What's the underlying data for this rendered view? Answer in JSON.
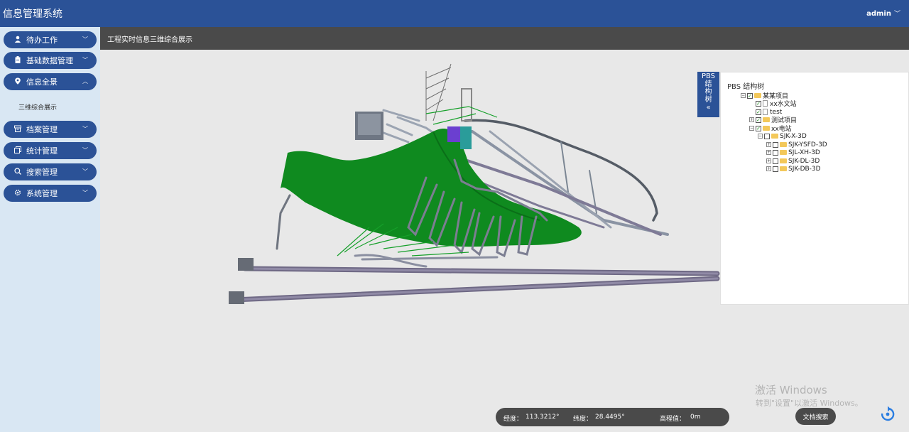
{
  "app": {
    "title": "信息管理系统",
    "user": "admin"
  },
  "sidebar": {
    "items": [
      {
        "label": "待办工作",
        "icon": "user-icon"
      },
      {
        "label": "基础数据管理",
        "icon": "clipboard-icon"
      },
      {
        "label": "信息全景",
        "icon": "location-pin-icon"
      },
      {
        "label": "档案管理",
        "icon": "archive-icon"
      },
      {
        "label": "统计管理",
        "icon": "copy-icon"
      },
      {
        "label": "搜索管理",
        "icon": "search-icon"
      },
      {
        "label": "系统管理",
        "icon": "gear-icon"
      }
    ],
    "submenu": "三维综合展示"
  },
  "header": {
    "title": "工程实时信息三维综合展示"
  },
  "pbs": {
    "tab_label": [
      "PBS",
      "结",
      "构",
      "树",
      "«"
    ],
    "title": "PBS 结构树",
    "tree": [
      {
        "label": "某某项目",
        "expander": "−",
        "check": "✓",
        "kind": "folder"
      },
      {
        "label": "xx水文站",
        "expander": "",
        "check": "✓",
        "kind": "file"
      },
      {
        "label": "test",
        "expander": "",
        "check": "✓",
        "kind": "file"
      },
      {
        "label": "测试项目",
        "expander": "+",
        "check": "✓",
        "kind": "folder"
      },
      {
        "label": "xx电站",
        "expander": "−",
        "check": "✓",
        "kind": "folder"
      },
      {
        "label": "SJK-X-3D",
        "expander": "−",
        "check": "",
        "kind": "folder"
      },
      {
        "label": "SJK-YSFD-3D",
        "expander": "+",
        "check": "",
        "kind": "folder"
      },
      {
        "label": "SJL-XH-3D",
        "expander": "+",
        "check": "",
        "kind": "folder"
      },
      {
        "label": "SJK-DL-3D",
        "expander": "+",
        "check": "",
        "kind": "folder"
      },
      {
        "label": "SJK-DB-3D",
        "expander": "+",
        "check": "",
        "kind": "folder"
      }
    ]
  },
  "coords": {
    "lon_label": "经度：",
    "lon": "113.3212°",
    "lat_label": "纬度：",
    "lat": "28.4495°",
    "alt_label": "高程值：",
    "alt": "0m"
  },
  "doc_search_label": "文档搜索",
  "watermark": {
    "line1": "激活 Windows",
    "line2": "转到\"设置\"以激活 Windows。"
  },
  "colors": {
    "primary": "#2b5297",
    "terrain": "#0f8a1f",
    "pipe": "#7a7288"
  }
}
